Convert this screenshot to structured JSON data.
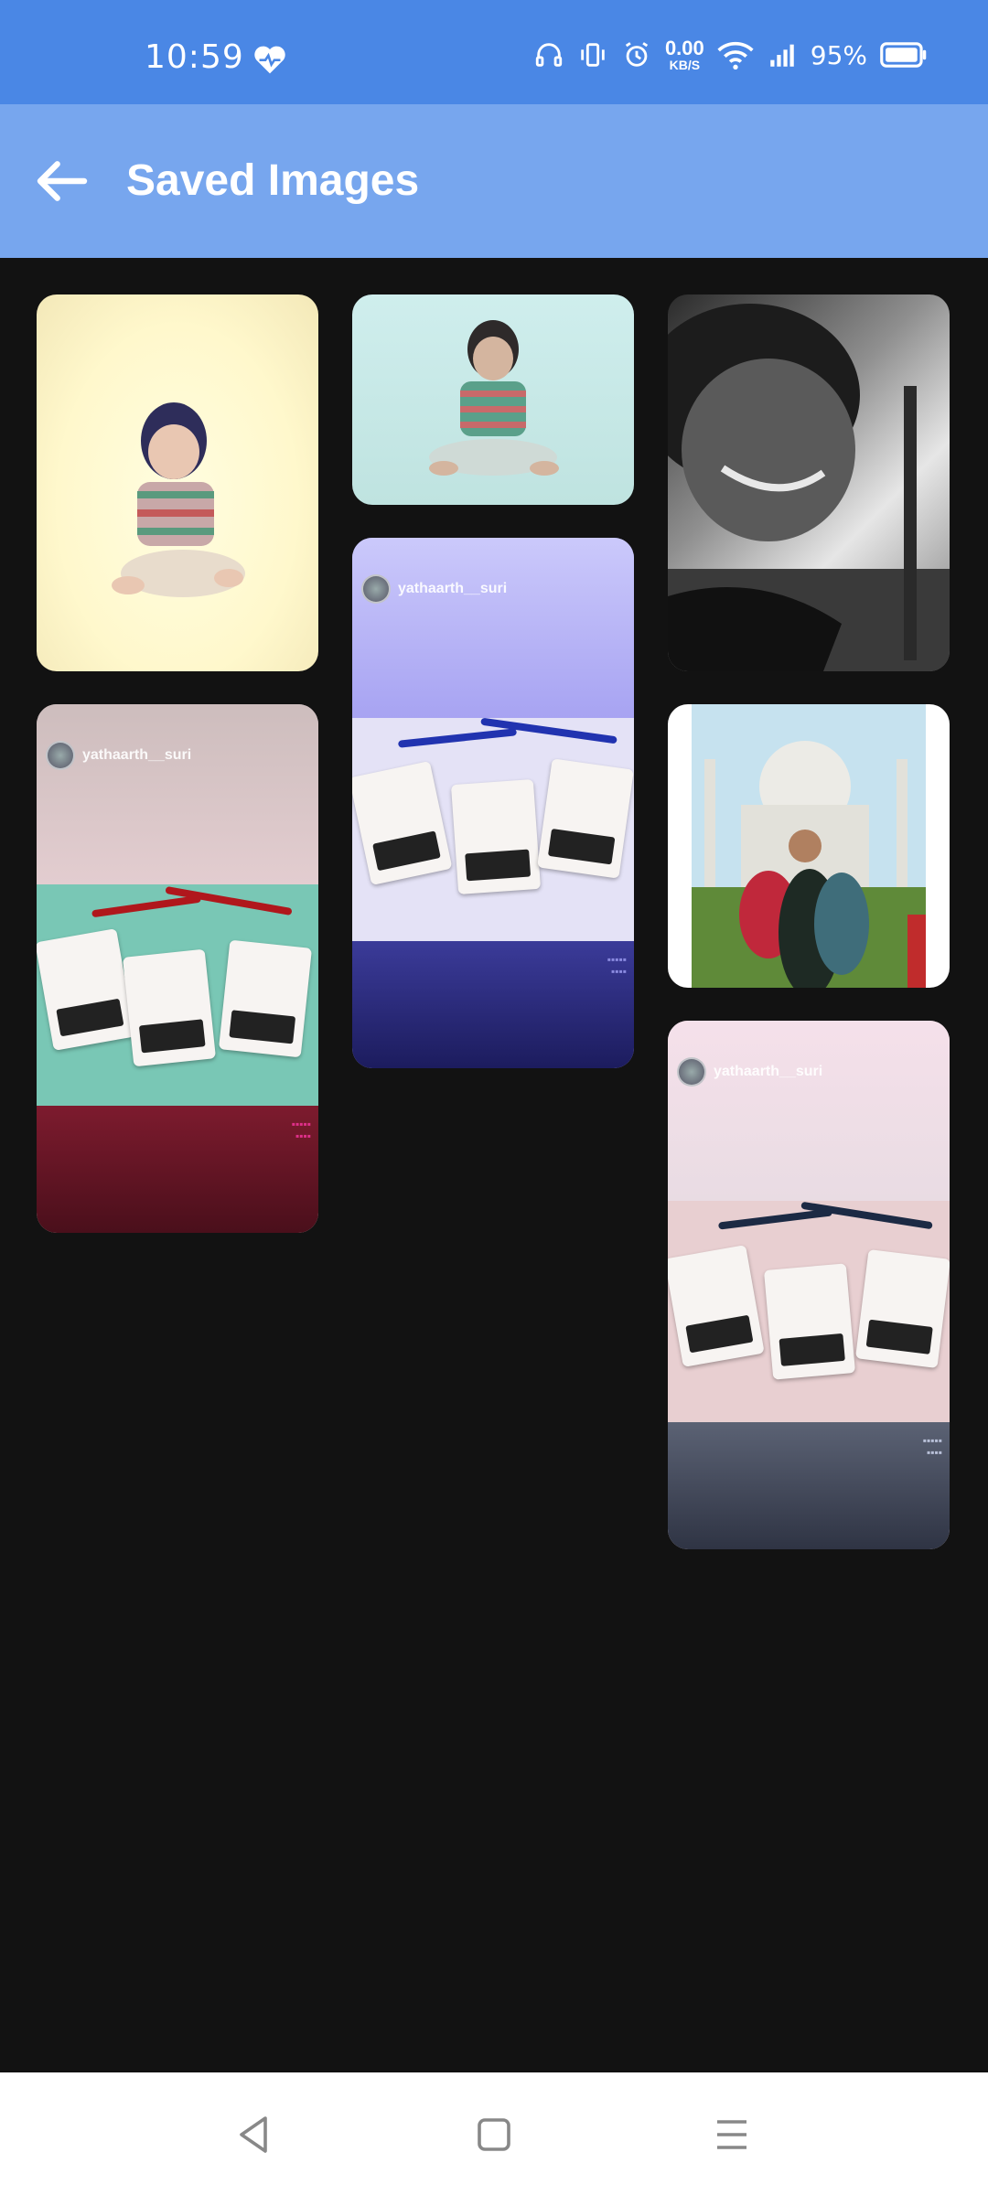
{
  "status_bar": {
    "time": "10:59",
    "net_speed_value": "0.00",
    "net_speed_unit": "KB/S",
    "battery": "95%"
  },
  "app_bar": {
    "title": "Saved Images",
    "back_icon": "arrow-left-icon"
  },
  "gallery": {
    "story_username": "yathaarth__suri",
    "story_username_alt": "yathaarth__suri",
    "story_username_alt2": "yathaarth__suri"
  },
  "colors": {
    "status_bar_bg": "#4A87E5",
    "app_bar_bg": "#77A6EE",
    "page_bg": "#121212",
    "nav_bar_bg": "#FFFFFF"
  },
  "nav_bar": {
    "back": "triangle-back-icon",
    "home": "square-home-icon",
    "menu": "hamburger-menu-icon"
  }
}
